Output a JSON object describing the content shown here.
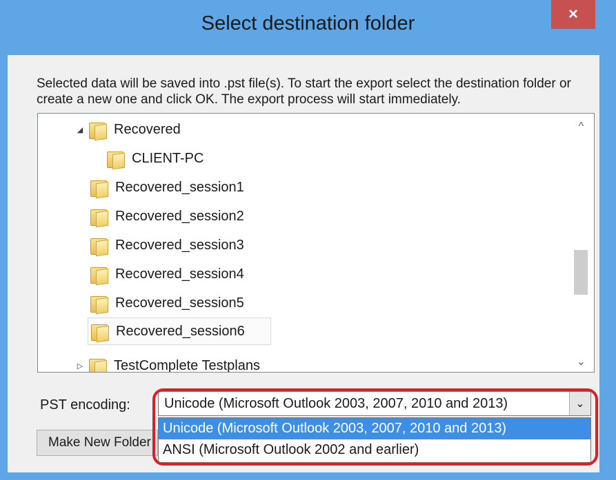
{
  "dialog": {
    "title": "Select destination folder",
    "close_label": "×",
    "description": "Selected data will be saved into .pst file(s). To start the export select the destination folder or create a new one and click OK. The export process will start immediately."
  },
  "tree": {
    "items": [
      {
        "label": "Recovered",
        "expander": "◢"
      },
      {
        "label": "CLIENT-PC",
        "expander": ""
      },
      {
        "label": "Recovered_session1",
        "expander": ""
      },
      {
        "label": "Recovered_session2",
        "expander": ""
      },
      {
        "label": "Recovered_session3",
        "expander": ""
      },
      {
        "label": "Recovered_session4",
        "expander": ""
      },
      {
        "label": "Recovered_session5",
        "expander": ""
      },
      {
        "label": "Recovered_session6",
        "expander": ""
      },
      {
        "label": "TestComplete Testplans",
        "expander": "▷"
      }
    ],
    "scroll_up": "^",
    "scroll_down": "⌄"
  },
  "encoding": {
    "label": "PST encoding:",
    "selected": "Unicode (Microsoft Outlook 2003, 2007, 2010 and 2013)",
    "arrow": "⌄",
    "options": [
      "Unicode (Microsoft Outlook 2003, 2007, 2010 and 2013)",
      "ANSI (Microsoft Outlook 2002 and earlier)"
    ]
  },
  "buttons": {
    "make_new_folder": "Make New Folder"
  },
  "colors": {
    "titlebar": "#5ea6e6",
    "close": "#c75050",
    "highlight": "#3d8ee6",
    "annotation_ring": "#d72128"
  }
}
